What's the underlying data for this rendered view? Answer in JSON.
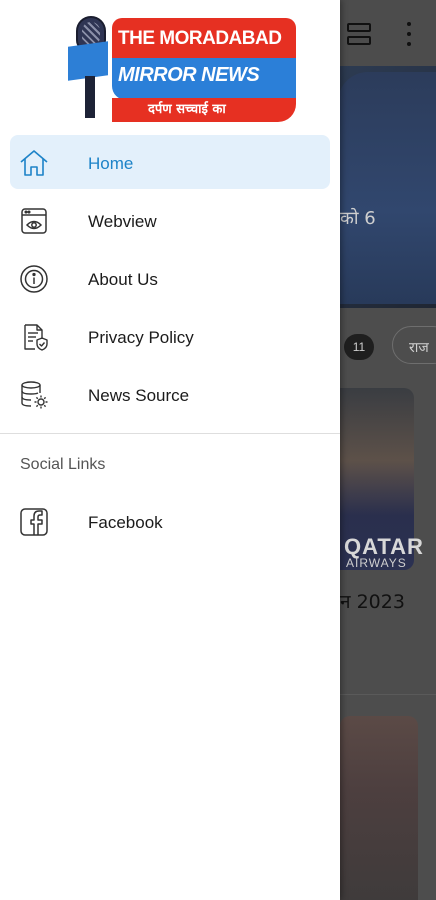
{
  "background": {
    "hero_text": "को 6",
    "chip_count": "11",
    "chip_category": "राज",
    "card1_brand": "QATAR",
    "card1_brand_sub": "AIRWAYS",
    "card1_title": "न 2023"
  },
  "logo": {
    "line1": "THE MORADABAD",
    "line2": "MIRROR NEWS",
    "tagline": "दर्पण सच्चाई का"
  },
  "menu": {
    "items": [
      {
        "label": "Home",
        "icon": "home-icon",
        "active": true
      },
      {
        "label": "Webview",
        "icon": "webview-icon",
        "active": false
      },
      {
        "label": "About Us",
        "icon": "info-icon",
        "active": false
      },
      {
        "label": "Privacy Policy",
        "icon": "privacy-policy-icon",
        "active": false
      },
      {
        "label": "News Source",
        "icon": "news-source-icon",
        "active": false
      }
    ]
  },
  "social": {
    "section_label": "Social Links",
    "items": [
      {
        "label": "Facebook",
        "icon": "facebook-icon"
      }
    ]
  },
  "colors": {
    "accent": "#1d83c8",
    "active_bg": "#e3f0fb",
    "logo_red": "#e63022",
    "logo_blue": "#2b7fd8"
  }
}
